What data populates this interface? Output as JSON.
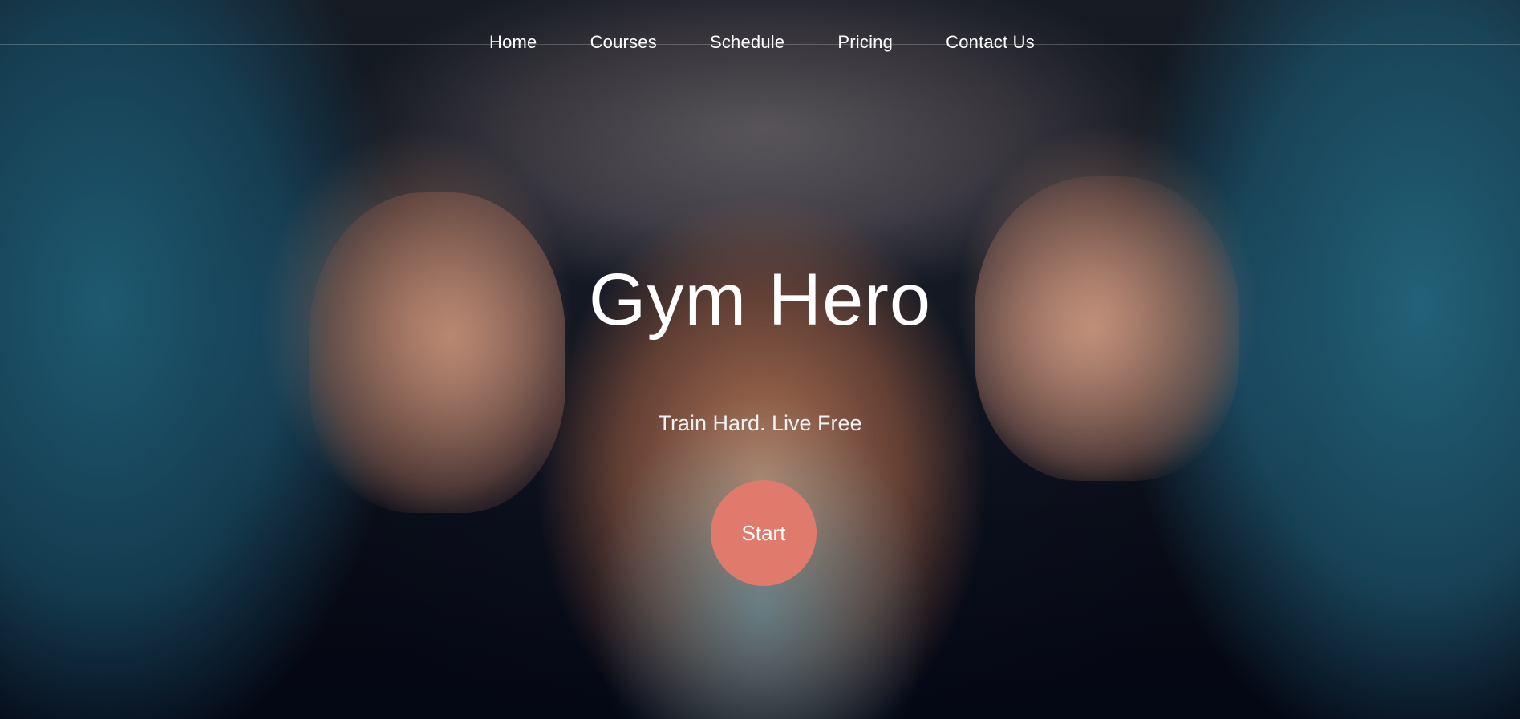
{
  "nav": {
    "items": [
      {
        "label": "Home"
      },
      {
        "label": "Courses"
      },
      {
        "label": "Schedule"
      },
      {
        "label": "Pricing"
      },
      {
        "label": "Contact Us"
      }
    ]
  },
  "hero": {
    "title": "Gym Hero",
    "tagline": "Train Hard. Live Free",
    "cta_label": "Start"
  },
  "colors": {
    "cta_background": "#e07a6c",
    "text": "#ffffff"
  }
}
